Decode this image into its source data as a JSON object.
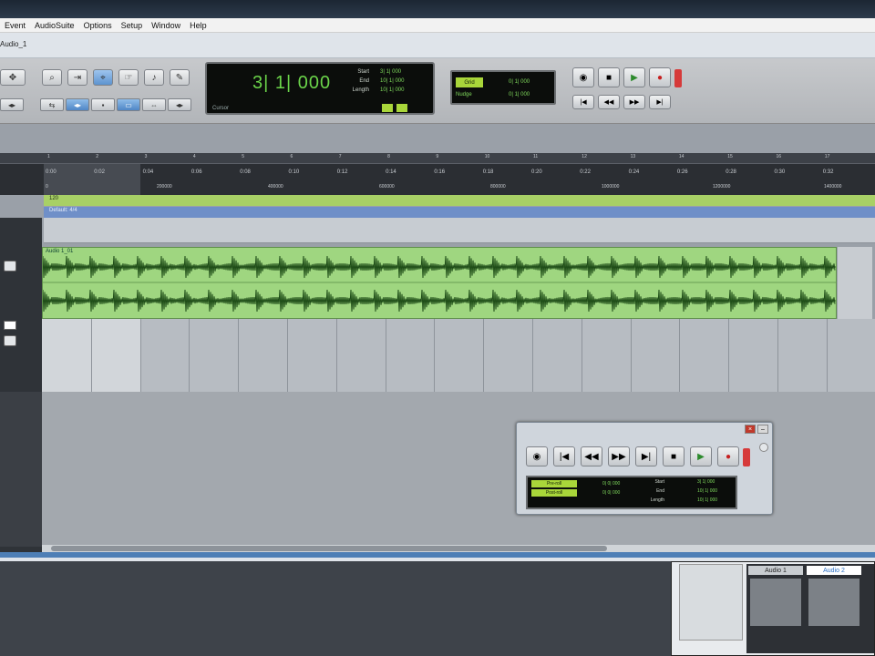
{
  "menu": {
    "items": [
      "Event",
      "AudioSuite",
      "Options",
      "Setup",
      "Window",
      "Help"
    ]
  },
  "window": {
    "title": "Audio_1"
  },
  "counter": {
    "main": "3| 1| 000",
    "labels": {
      "start": "Start",
      "end": "End",
      "length": "Length"
    },
    "values": {
      "start": "3| 1| 000",
      "end": "10| 1| 000",
      "length": "10| 1| 000"
    },
    "cursor_label": "Cursor"
  },
  "grid": {
    "grid_label": "Grid",
    "nudge_label": "Nudge",
    "grid_value": "0| 1| 000",
    "nudge_value": "0| 1| 000"
  },
  "ruler": {
    "bars": [
      "1",
      "2",
      "3",
      "4",
      "5",
      "6",
      "7",
      "8",
      "9",
      "10",
      "11",
      "12",
      "13",
      "14",
      "15",
      "16",
      "17"
    ],
    "times": [
      "0:00",
      "0:02",
      "0:04",
      "0:06",
      "0:08",
      "0:10",
      "0:12",
      "0:14",
      "0:16",
      "0:18",
      "0:20",
      "0:22",
      "0:24",
      "0:26",
      "0:28",
      "0:30",
      "0:32"
    ],
    "samples": [
      "0",
      "200000",
      "400000",
      "600000",
      "800000",
      "1000000",
      "1200000",
      "1400000"
    ]
  },
  "rulers": {
    "tempo": "120",
    "meter": "Default: 4/4"
  },
  "region": {
    "name": "Audio 1_01"
  },
  "transport": {
    "pre": "0| 0| 000",
    "post": "0| 0| 000",
    "pre_label": "Pre-roll",
    "post_label": "Post-roll",
    "start_label": "Start",
    "end_label": "End",
    "length_label": "Length",
    "start_value": "3| 1| 000",
    "end_value": "10| 1| 000",
    "length_value": "10| 1| 000"
  },
  "mixer": {
    "ch1": "Audio 1",
    "ch2": "Audio 2"
  },
  "colors": {
    "accent_green": "#6bd44a",
    "region_green": "#9fd680",
    "tempo_green": "#a8d066",
    "meter_blue": "#6f8fc8",
    "select_blue": "#4e7fb6"
  }
}
